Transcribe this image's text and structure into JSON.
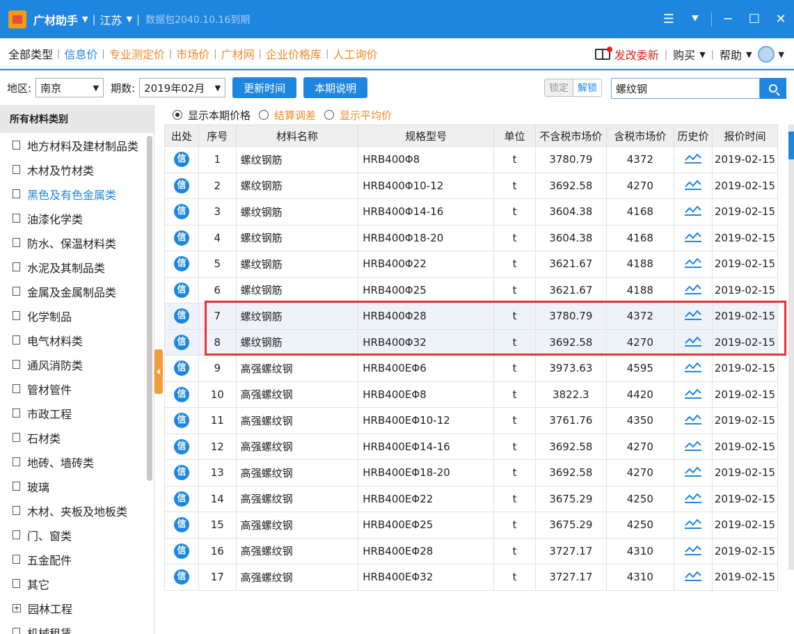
{
  "title": {
    "app": "广材助手",
    "region": "江苏",
    "expire": "数据包2040.10.16到期"
  },
  "nav": {
    "items": [
      "全部类型",
      "信息价",
      "专业测定价",
      "市场价",
      "广材网",
      "企业价格库",
      "人工询价"
    ],
    "active_index": 1,
    "notice": "发改委新",
    "buy": "购买",
    "help": "帮助"
  },
  "filter": {
    "region_label": "地区:",
    "region_value": "南京",
    "period_label": "期数:",
    "period_value": "2019年02月",
    "update_btn": "更新时间",
    "desc_btn": "本期说明",
    "lock": "锁定",
    "unlock": "解锁",
    "search_value": "螺纹钢"
  },
  "sidebar": {
    "header": "所有材料类别",
    "items": [
      "地方材料及建材制品类",
      "木材及竹材类",
      "黑色及有色金属类",
      "油漆化学类",
      "防水、保温材料类",
      "水泥及其制品类",
      "金属及金属制品类",
      "化学制品",
      "电气材料类",
      "通风消防类",
      "管材管件",
      "市政工程",
      "石材类",
      "地砖、墙砖类",
      "玻璃",
      "木材、夹板及地板类",
      "门、窗类",
      "五金配件",
      "其它",
      "园林工程",
      "机械租赁"
    ],
    "active_index": 2
  },
  "options": {
    "opt1": "显示本期价格",
    "opt2": "结算调差",
    "opt3": "显示平均价"
  },
  "table": {
    "headers": [
      "出处",
      "序号",
      "材料名称",
      "规格型号",
      "单位",
      "不含税市场价",
      "含税市场价",
      "历史价",
      "报价时间"
    ],
    "source_badge": "信",
    "rows": [
      [
        "1",
        "螺纹钢筋",
        "HRB400Φ8",
        "t",
        "3780.79",
        "4372",
        "2019-02-15"
      ],
      [
        "2",
        "螺纹钢筋",
        "HRB400Φ10-12",
        "t",
        "3692.58",
        "4270",
        "2019-02-15"
      ],
      [
        "3",
        "螺纹钢筋",
        "HRB400Φ14-16",
        "t",
        "3604.38",
        "4168",
        "2019-02-15"
      ],
      [
        "4",
        "螺纹钢筋",
        "HRB400Φ18-20",
        "t",
        "3604.38",
        "4168",
        "2019-02-15"
      ],
      [
        "5",
        "螺纹钢筋",
        "HRB400Φ22",
        "t",
        "3621.67",
        "4188",
        "2019-02-15"
      ],
      [
        "6",
        "螺纹钢筋",
        "HRB400Φ25",
        "t",
        "3621.67",
        "4188",
        "2019-02-15"
      ],
      [
        "7",
        "螺纹钢筋",
        "HRB400Φ28",
        "t",
        "3780.79",
        "4372",
        "2019-02-15"
      ],
      [
        "8",
        "螺纹钢筋",
        "HRB400Φ32",
        "t",
        "3692.58",
        "4270",
        "2019-02-15"
      ],
      [
        "9",
        "高强螺纹钢",
        "HRB400EΦ6",
        "t",
        "3973.63",
        "4595",
        "2019-02-15"
      ],
      [
        "10",
        "高强螺纹钢",
        "HRB400EΦ8",
        "t",
        "3822.3",
        "4420",
        "2019-02-15"
      ],
      [
        "11",
        "高强螺纹钢",
        "HRB400EΦ10-12",
        "t",
        "3761.76",
        "4350",
        "2019-02-15"
      ],
      [
        "12",
        "高强螺纹钢",
        "HRB400EΦ14-16",
        "t",
        "3692.58",
        "4270",
        "2019-02-15"
      ],
      [
        "13",
        "高强螺纹钢",
        "HRB400EΦ18-20",
        "t",
        "3692.58",
        "4270",
        "2019-02-15"
      ],
      [
        "14",
        "高强螺纹钢",
        "HRB400EΦ22",
        "t",
        "3675.29",
        "4250",
        "2019-02-15"
      ],
      [
        "15",
        "高强螺纹钢",
        "HRB400EΦ25",
        "t",
        "3675.29",
        "4250",
        "2019-02-15"
      ],
      [
        "16",
        "高强螺纹钢",
        "HRB400EΦ28",
        "t",
        "3727.17",
        "4310",
        "2019-02-15"
      ],
      [
        "17",
        "高强螺纹钢",
        "HRB400EΦ32",
        "t",
        "3727.17",
        "4310",
        "2019-02-15"
      ]
    ],
    "highlighted_rows": [
      7,
      8
    ]
  },
  "colors": {
    "brand_blue": "#1f86e0",
    "accent_orange": "#f08a24",
    "highlight_red": "#e53333"
  }
}
